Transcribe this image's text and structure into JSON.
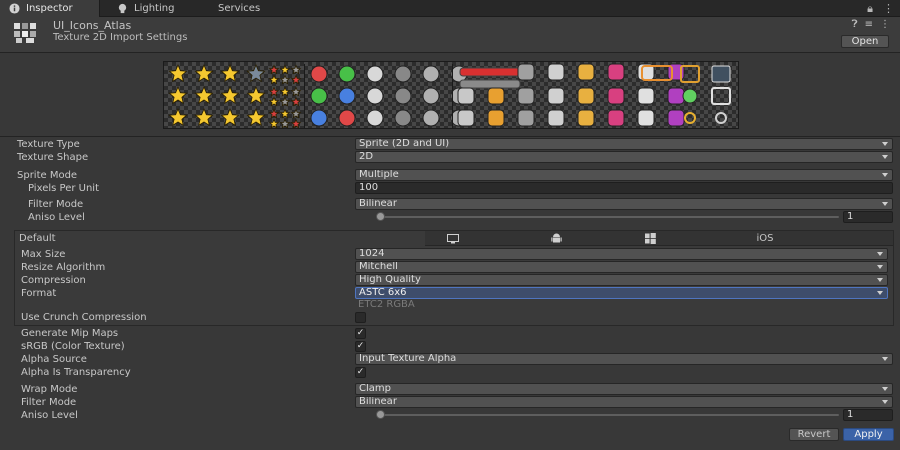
{
  "tabs": [
    {
      "label": "Inspector",
      "icon": "info-icon"
    },
    {
      "label": "Lighting",
      "icon": "bulb-icon"
    },
    {
      "label": "Services"
    }
  ],
  "asset": {
    "name": "UI_Icons_Atlas",
    "subtitle": "Texture 2D Import Settings",
    "open_label": "Open"
  },
  "properties": {
    "texture_type": {
      "label": "Texture Type",
      "value": "Sprite (2D and UI)"
    },
    "texture_shape": {
      "label": "Texture Shape",
      "value": "2D"
    },
    "sprite_mode": {
      "label": "Sprite Mode",
      "value": "Multiple"
    },
    "pixels_per_unit": {
      "label": "Pixels Per Unit",
      "value": "100"
    },
    "filter_mode": {
      "label": "Filter Mode",
      "value": "Bilinear"
    },
    "aniso_level": {
      "label": "Aniso Level",
      "value": "1",
      "slider_fraction": 0.0
    }
  },
  "platform": {
    "default_label": "Default",
    "tabs": [
      {
        "icon": "monitor-icon"
      },
      {
        "icon": "android-icon"
      },
      {
        "icon": "windows-icon"
      },
      {
        "label": "iOS"
      }
    ],
    "max_size": {
      "label": "Max Size",
      "value": "1024"
    },
    "resize_algorithm": {
      "label": "Resize Algorithm",
      "value": "Mitchell"
    },
    "compression": {
      "label": "Compression",
      "value": "High Quality"
    },
    "format": {
      "label": "Format",
      "value": "ASTC 6x6",
      "dropdown_option": "ETC2 RGBA"
    },
    "crunch": {
      "label": "Use Crunch Compression",
      "checked": false
    }
  },
  "advanced": {
    "generate_mip_maps": {
      "label": "Generate Mip Maps",
      "checked": true
    },
    "srgb": {
      "label": "sRGB (Color Texture)",
      "checked": true
    },
    "alpha_source": {
      "label": "Alpha Source",
      "value": "Input Texture Alpha"
    },
    "alpha_is_transparency": {
      "label": "Alpha Is Transparency",
      "checked": true
    },
    "wrap_mode": {
      "label": "Wrap Mode",
      "value": "Clamp"
    },
    "filter_mode": {
      "label": "Filter Mode",
      "value": "Bilinear"
    },
    "aniso_level": {
      "label": "Aniso Level",
      "value": "1",
      "slider_fraction": 0.0
    }
  },
  "footer": {
    "revert_label": "Revert",
    "apply_label": "Apply"
  },
  "colors": {
    "accent": "#3b63a8",
    "selection": "#4f75c0",
    "background": "#383838"
  }
}
